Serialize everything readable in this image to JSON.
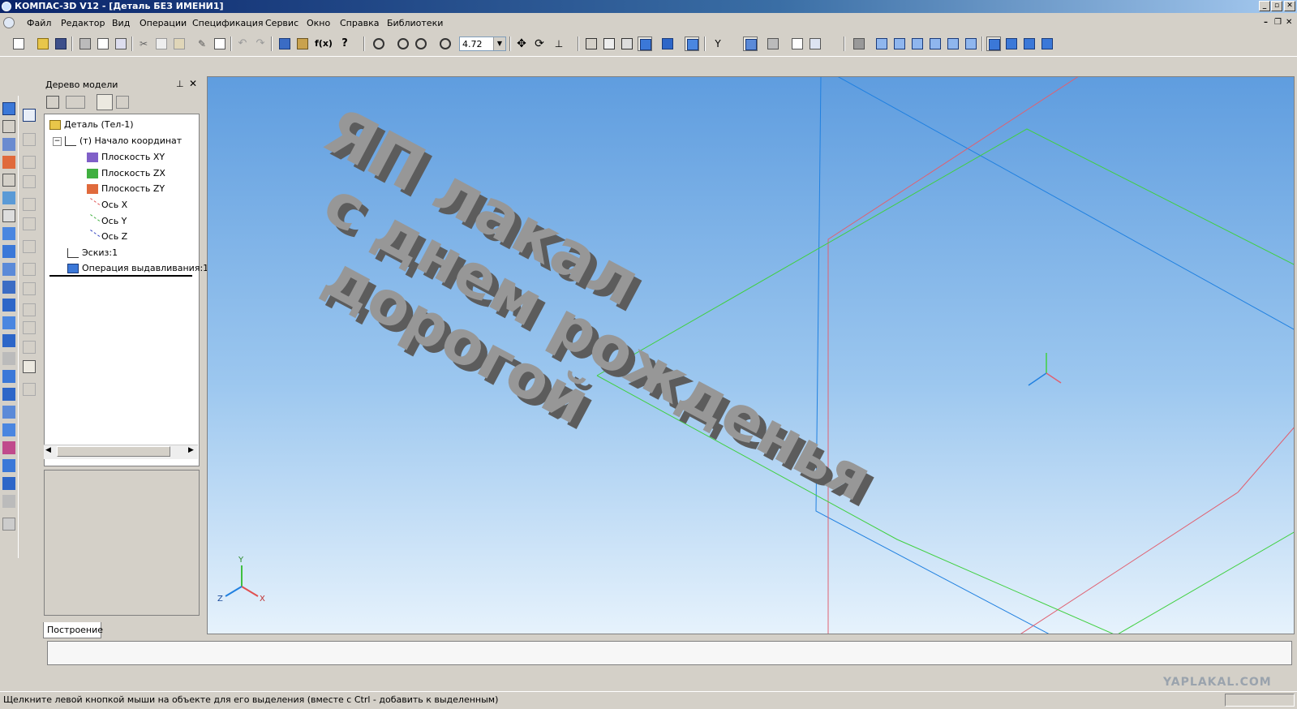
{
  "window": {
    "title": "КОМПАС-3D V12 - [Деталь БЕЗ ИМЕНИ1]"
  },
  "menu": {
    "items": [
      "Файл",
      "Редактор",
      "Вид",
      "Операции",
      "Спецификация",
      "Сервис",
      "Окно",
      "Справка",
      "Библиотеки"
    ]
  },
  "toolbar": {
    "zoom_value": "4.72"
  },
  "tree_panel": {
    "title": "Дерево модели",
    "nodes": [
      "Деталь (Тел-1)",
      "(т) Начало координат",
      "Плоскость XY",
      "Плоскость ZX",
      "Плоскость ZY",
      "Ось X",
      "Ось Y",
      "Ось Z",
      "Эскиз:1",
      "Операция выдавливания:1"
    ],
    "tab_label": "Построение"
  },
  "viewport": {
    "extruded_text_lines": [
      "ЯП лакал",
      "с днем рожденья",
      "дорогой"
    ],
    "triad": {
      "x": "X",
      "y": "Y",
      "z": "Z"
    }
  },
  "statusbar": {
    "hint": "Щелкните левой кнопкой мыши на объекте для его выделения (вместе с Ctrl - добавить к выделенным)"
  },
  "watermark": "YAPLAKAL.COM",
  "colors": {
    "title_start": "#0a246a",
    "title_end": "#a6caf0",
    "viewport_top": "#5f9ddf",
    "viewport_bottom": "#e6f2fc",
    "extrusion_gray": "#8c8c8c",
    "axis_x": "#e05050",
    "axis_y": "#40c040",
    "axis_z": "#2080e0"
  }
}
